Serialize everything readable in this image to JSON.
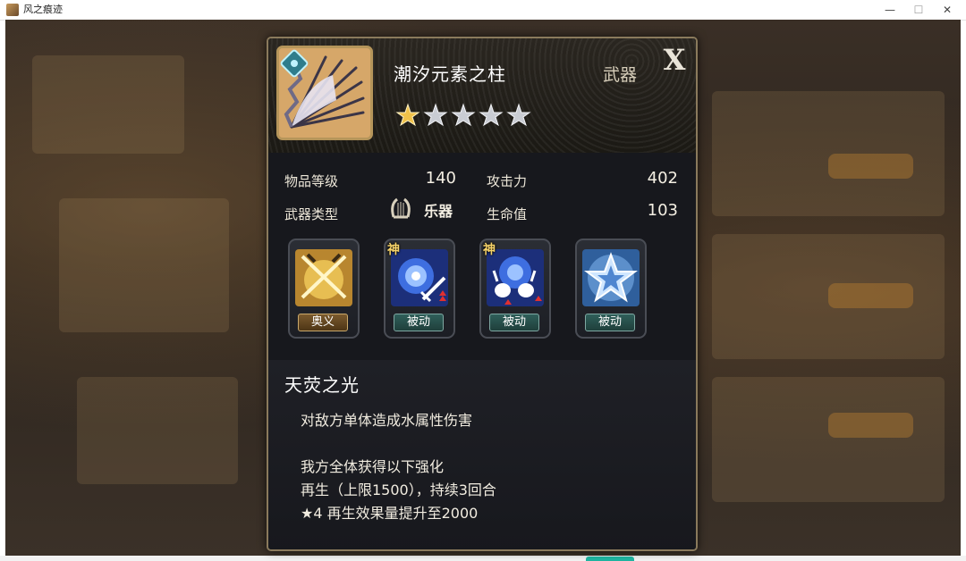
{
  "window": {
    "title": "风之痕迹",
    "minimize": "—",
    "maximize": "☐",
    "close": "✕"
  },
  "item": {
    "name": "潮汐元素之柱",
    "type": "武器",
    "close_label": "X",
    "star_rating": 1,
    "star_max": 5
  },
  "stats": {
    "level_label": "物品等级",
    "level_value": "140",
    "attack_label": "攻击力",
    "attack_value": "402",
    "weapon_type_label": "武器类型",
    "weapon_type_value": "乐器",
    "hp_label": "生命值",
    "hp_value": "103"
  },
  "skills": [
    {
      "tag": "奥义",
      "badge": "",
      "icon": "crossed-swords-icon"
    },
    {
      "tag": "被动",
      "badge": "神",
      "icon": "water-vortex-sword-icon"
    },
    {
      "tag": "被动",
      "badge": "神",
      "icon": "water-vortex-rabbits-icon"
    },
    {
      "tag": "被动",
      "badge": "",
      "icon": "blue-star-icon"
    }
  ],
  "description": {
    "skill_name": "天荧之光",
    "lines": [
      "对敌方单体造成水属性伤害",
      "我方全体获得以下强化",
      "再生（上限1500），持续3回合",
      "★4 再生效果量提升至2000"
    ]
  },
  "colors": {
    "panel_border": "#8a7a5c",
    "gold_tag": "#7a5a2e",
    "teal_tag": "#2f5f5a",
    "star_gold": "#f0c24a",
    "star_silver": "#c9ccd3"
  }
}
